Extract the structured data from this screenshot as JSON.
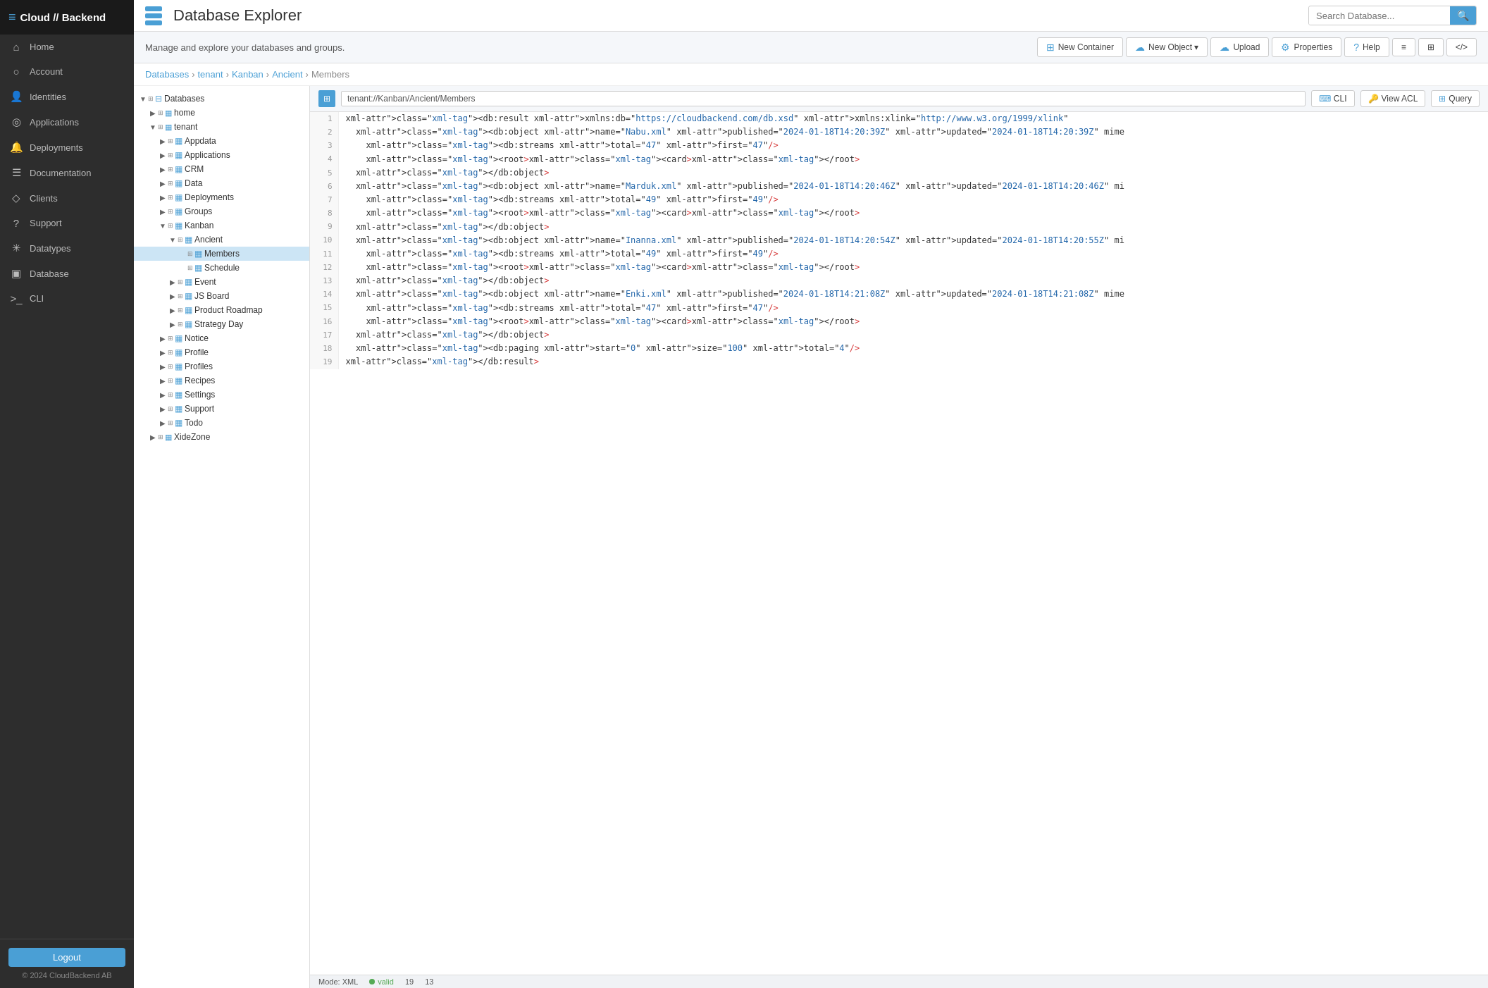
{
  "brand": {
    "name": "Cloud // Backend",
    "icon": "≡"
  },
  "sidebar": {
    "items": [
      {
        "id": "home",
        "label": "Home",
        "icon": "⌂"
      },
      {
        "id": "account",
        "label": "Account",
        "icon": "○"
      },
      {
        "id": "identities",
        "label": "Identities",
        "icon": "👤"
      },
      {
        "id": "applications",
        "label": "Applications",
        "icon": "◎"
      },
      {
        "id": "deployments",
        "label": "Deployments",
        "icon": "🔔"
      },
      {
        "id": "documentation",
        "label": "Documentation",
        "icon": "☰"
      },
      {
        "id": "clients",
        "label": "Clients",
        "icon": "◇"
      },
      {
        "id": "support",
        "label": "Support",
        "icon": "?"
      },
      {
        "id": "datatypes",
        "label": "Datatypes",
        "icon": "✳"
      },
      {
        "id": "database",
        "label": "Database",
        "icon": "▣"
      },
      {
        "id": "cli",
        "label": "CLI",
        "icon": ">_"
      }
    ],
    "logout_label": "Logout",
    "copyright": "© 2024 CloudBackend AB"
  },
  "topbar": {
    "title": "Database Explorer",
    "subtitle": "Manage and explore your databases and groups.",
    "search_placeholder": "Search Database..."
  },
  "toolbar": {
    "new_container": "New Container",
    "new_object": "New Object ▾",
    "upload": "Upload",
    "properties": "Properties",
    "help": "Help",
    "view_icons": [
      "≡",
      "⊞",
      "</>"
    ]
  },
  "breadcrumb": {
    "items": [
      "Databases",
      "tenant",
      "Kanban",
      "Ancient",
      "Members"
    ]
  },
  "xml_toolbar": {
    "path": "tenant://Kanban/Ancient/Members",
    "cli": "CLI",
    "view_acl": "View ACL",
    "query": "Query"
  },
  "tree": {
    "items": [
      {
        "id": "databases-root",
        "label": "Databases",
        "indent": 0,
        "expanded": true,
        "type": "root"
      },
      {
        "id": "home",
        "label": "home",
        "indent": 1,
        "expanded": false,
        "type": "db"
      },
      {
        "id": "tenant",
        "label": "tenant",
        "indent": 1,
        "expanded": true,
        "type": "db"
      },
      {
        "id": "appdata",
        "label": "Appdata",
        "indent": 2,
        "expanded": false,
        "type": "folder"
      },
      {
        "id": "applications",
        "label": "Applications",
        "indent": 2,
        "expanded": false,
        "type": "folder"
      },
      {
        "id": "crm",
        "label": "CRM",
        "indent": 2,
        "expanded": false,
        "type": "folder"
      },
      {
        "id": "data",
        "label": "Data",
        "indent": 2,
        "expanded": false,
        "type": "folder"
      },
      {
        "id": "deployments",
        "label": "Deployments",
        "indent": 2,
        "expanded": false,
        "type": "folder"
      },
      {
        "id": "groups",
        "label": "Groups",
        "indent": 2,
        "expanded": false,
        "type": "folder"
      },
      {
        "id": "kanban",
        "label": "Kanban",
        "indent": 2,
        "expanded": true,
        "type": "folder"
      },
      {
        "id": "ancient",
        "label": "Ancient",
        "indent": 3,
        "expanded": true,
        "type": "subfolder"
      },
      {
        "id": "members",
        "label": "Members",
        "indent": 4,
        "expanded": false,
        "type": "item",
        "selected": true
      },
      {
        "id": "schedule",
        "label": "Schedule",
        "indent": 4,
        "expanded": false,
        "type": "item"
      },
      {
        "id": "event",
        "label": "Event",
        "indent": 3,
        "expanded": false,
        "type": "subfolder"
      },
      {
        "id": "js-board",
        "label": "JS Board",
        "indent": 3,
        "expanded": false,
        "type": "subfolder"
      },
      {
        "id": "product-roadmap",
        "label": "Product Roadmap",
        "indent": 3,
        "expanded": false,
        "type": "subfolder"
      },
      {
        "id": "strategy-day",
        "label": "Strategy Day",
        "indent": 3,
        "expanded": false,
        "type": "subfolder"
      },
      {
        "id": "notice",
        "label": "Notice",
        "indent": 2,
        "expanded": false,
        "type": "folder"
      },
      {
        "id": "profile",
        "label": "Profile",
        "indent": 2,
        "expanded": false,
        "type": "folder"
      },
      {
        "id": "profiles",
        "label": "Profiles",
        "indent": 2,
        "expanded": false,
        "type": "folder"
      },
      {
        "id": "recipes",
        "label": "Recipes",
        "indent": 2,
        "expanded": false,
        "type": "folder"
      },
      {
        "id": "settings",
        "label": "Settings",
        "indent": 2,
        "expanded": false,
        "type": "folder"
      },
      {
        "id": "support",
        "label": "Support",
        "indent": 2,
        "expanded": false,
        "type": "folder"
      },
      {
        "id": "todo",
        "label": "Todo",
        "indent": 2,
        "expanded": false,
        "type": "folder"
      },
      {
        "id": "xidezone",
        "label": "XideZone",
        "indent": 1,
        "expanded": false,
        "type": "db"
      }
    ]
  },
  "xml_content": {
    "lines": [
      {
        "num": 1,
        "text": "<db:result xmlns:db=\"https://cloudbackend.com/db.xsd\" xmlns:xlink=\"http://www.w3.org/1999/xlink\""
      },
      {
        "num": 2,
        "text": "  <db:object name=\"Nabu.xml\" published=\"2024-01-18T14:20:39Z\" updated=\"2024-01-18T14:20:39Z\" mime"
      },
      {
        "num": 3,
        "text": "    <db:streams total=\"47\" first=\"47\"/>"
      },
      {
        "num": 4,
        "text": "    <root><card></root>"
      },
      {
        "num": 5,
        "text": "  </db:object>"
      },
      {
        "num": 6,
        "text": "  <db:object name=\"Marduk.xml\" published=\"2024-01-18T14:20:46Z\" updated=\"2024-01-18T14:20:46Z\" mi"
      },
      {
        "num": 7,
        "text": "    <db:streams total=\"49\" first=\"49\"/>"
      },
      {
        "num": 8,
        "text": "    <root><card></root>"
      },
      {
        "num": 9,
        "text": "  </db:object>"
      },
      {
        "num": 10,
        "text": "  <db:object name=\"Inanna.xml\" published=\"2024-01-18T14:20:54Z\" updated=\"2024-01-18T14:20:55Z\" mi"
      },
      {
        "num": 11,
        "text": "    <db:streams total=\"49\" first=\"49\"/>"
      },
      {
        "num": 12,
        "text": "    <root><card></root>"
      },
      {
        "num": 13,
        "text": "  </db:object>"
      },
      {
        "num": 14,
        "text": "  <db:object name=\"Enki.xml\" published=\"2024-01-18T14:21:08Z\" updated=\"2024-01-18T14:21:08Z\" mime"
      },
      {
        "num": 15,
        "text": "    <db:streams total=\"47\" first=\"47\"/>"
      },
      {
        "num": 16,
        "text": "    <root><card></root>"
      },
      {
        "num": 17,
        "text": "  </db:object>"
      },
      {
        "num": 18,
        "text": "  <db:paging start=\"0\" size=\"100\" total=\"4\"/>"
      },
      {
        "num": 19,
        "text": "</db:result>"
      }
    ]
  },
  "statusbar": {
    "mode_label": "Mode: XML",
    "valid_label": "valid",
    "lines": "19",
    "cols": "13"
  }
}
